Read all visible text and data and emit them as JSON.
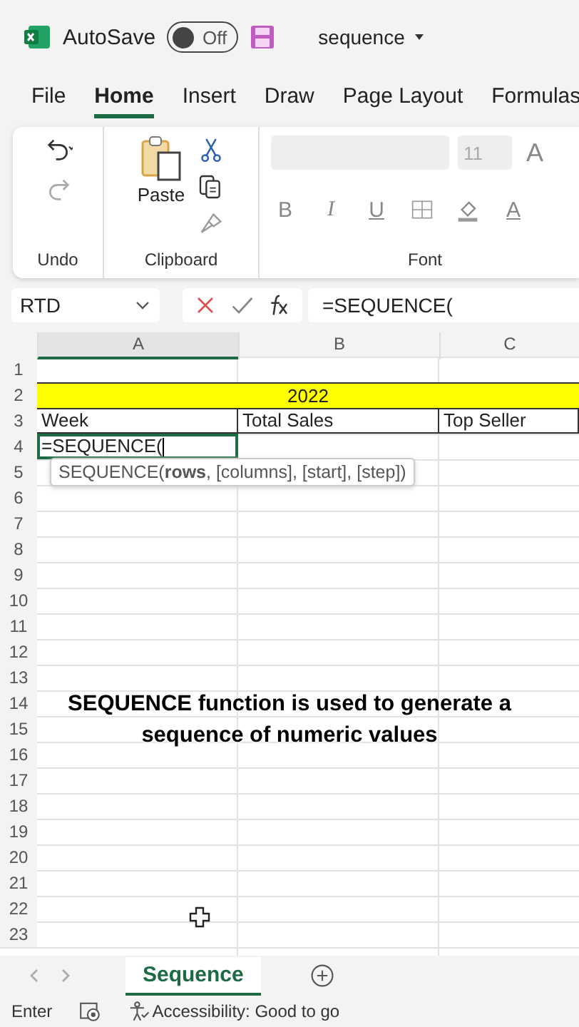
{
  "title_bar": {
    "autosave_label": "AutoSave",
    "autosave": {
      "on": false,
      "label": "Off"
    },
    "document": "sequence"
  },
  "tabs": [
    {
      "label": "File",
      "selected": false
    },
    {
      "label": "Home",
      "selected": true
    },
    {
      "label": "Insert",
      "selected": false
    },
    {
      "label": "Draw",
      "selected": false
    },
    {
      "label": "Page Layout",
      "selected": false
    },
    {
      "label": "Formulas",
      "selected": false
    }
  ],
  "ribbon": {
    "undo_group": "Undo",
    "paste": "Paste",
    "clipboard_group": "Clipboard",
    "font_size": "11",
    "grow_font": "A",
    "format_buttons": [
      "B",
      "I",
      "U"
    ],
    "font_color": "A",
    "font_group": "Font"
  },
  "formula_bar": {
    "name_box": "RTD",
    "formula": "=SEQUENCE("
  },
  "columns": [
    {
      "label": "A",
      "selected": true
    },
    {
      "label": "B",
      "selected": false
    },
    {
      "label": "C",
      "selected": false
    }
  ],
  "rows": [
    {
      "number": "1"
    },
    {
      "number": "2",
      "merged": "2022",
      "color": "#ffff00"
    },
    {
      "number": "3",
      "cells": [
        {
          "text": "Week",
          "selected": false
        },
        {
          "text": "Total Sales",
          "selected": false
        },
        {
          "text": "Top Seller",
          "selected": false
        }
      ]
    },
    {
      "number": "4",
      "cells": [
        {
          "text": "=SEQUENCE(",
          "selected": true
        }
      ]
    },
    {
      "number": "5"
    },
    {
      "number": "6"
    },
    {
      "number": "7"
    },
    {
      "number": "8"
    },
    {
      "number": "9"
    },
    {
      "number": "10"
    },
    {
      "number": "11"
    },
    {
      "number": "12"
    },
    {
      "number": "13"
    },
    {
      "number": "14"
    },
    {
      "number": "15"
    },
    {
      "number": "16"
    },
    {
      "number": "17"
    },
    {
      "number": "18"
    },
    {
      "number": "19"
    },
    {
      "number": "20"
    },
    {
      "number": "21"
    },
    {
      "number": "22"
    },
    {
      "number": "23"
    }
  ],
  "tooltip": "SEQUENCE(**rows**, [columns], [start], [step])",
  "caption": "SEQUENCE function is used to generate a sequence of numeric values",
  "sheet_tabs": [
    {
      "label": "Sequence",
      "selected": true
    }
  ],
  "status_bar": {
    "mode": "Enter",
    "accessibility": "Accessibility: Good to go"
  }
}
